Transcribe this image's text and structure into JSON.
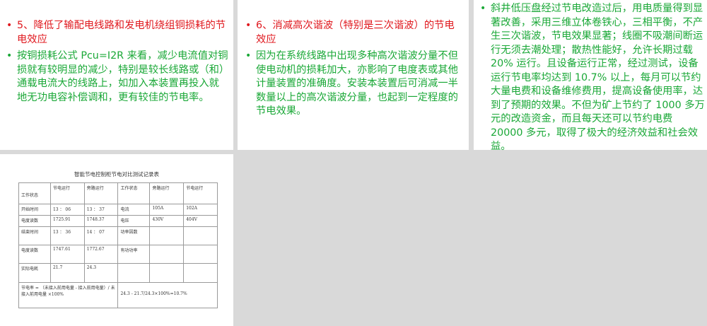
{
  "panel1": {
    "bullet1": "5、降低了输配电线路和发电机绕组铜损耗的节电效应",
    "bullet2": "按铜损耗公式 Pcu=I2R 来看，减少电流值对铜损就有较明显的减少，特别是较长线路或（和）通载电流大的线路上，如加入本装置再投入就地无功电容补偿调和，更有较佳的节电率。"
  },
  "panel2": {
    "bullet1": "6、消减高次谐波（特别是三次谐波）的节电效应",
    "bullet2": "因为在系统线路中出现多种高次谐波分量不但使电动机的损耗加大，亦影响了电度表或其他计量装置的准确度。安装本装置后可消减一半数量以上的高次谐波分量，也起到一定程度的节电效果。"
  },
  "panel3": {
    "bullet1": "斜井低压盘经过节电改造过后，用电质量得到显著改善，采用三维立体卷铁心，三相平衡，不产生三次谐波，节电效果显著；线圈不吸潮间断运行无须去潮处理；散热性能好，允许长期过载 20% 运行。且设备运行正常，经过测试，设备运行节电率均达到 10.7% 以上，每月可以节约大量电费和设备维修费用，提高设备使用率，达到了预期的效果。不但为矿上节约了 1000 多万元的改造资金，而且每天还可以节约电费 20000 多元，取得了极大的经济效益和社会效益。"
  },
  "record": {
    "title": "智能节电控制柜节电对比测试记录表",
    "header": [
      "工作状态",
      "节电运行",
      "旁路运行",
      "工作状态",
      "旁路运行",
      "节电运行"
    ],
    "rows": [
      [
        "开始时间",
        "13 ： 06",
        "13 ： 37",
        "电流",
        "105A",
        "102A"
      ],
      [
        "电度读数",
        "1725.91",
        "1748.37",
        "电压",
        "430V",
        "404V"
      ],
      [
        "结束时间",
        "13 ： 36",
        "14 ： 07",
        "功率因数",
        "",
        ""
      ],
      [
        "电度读数",
        "1747.61",
        "1772.67",
        "有功功率",
        "",
        ""
      ],
      [
        "实际电耗",
        "21.7",
        "24.3",
        "",
        "",
        ""
      ]
    ],
    "formula_label": "节电率 = （未接入前用电量 - 接入前用电量）/ 未接入前用电量 ×100%",
    "formula_value": "24.3 - 21.7/24.3×100%=10.7%"
  },
  "colors": {
    "red": "#e0191f",
    "green": "#1aa837",
    "background": "#d9d9d9"
  }
}
